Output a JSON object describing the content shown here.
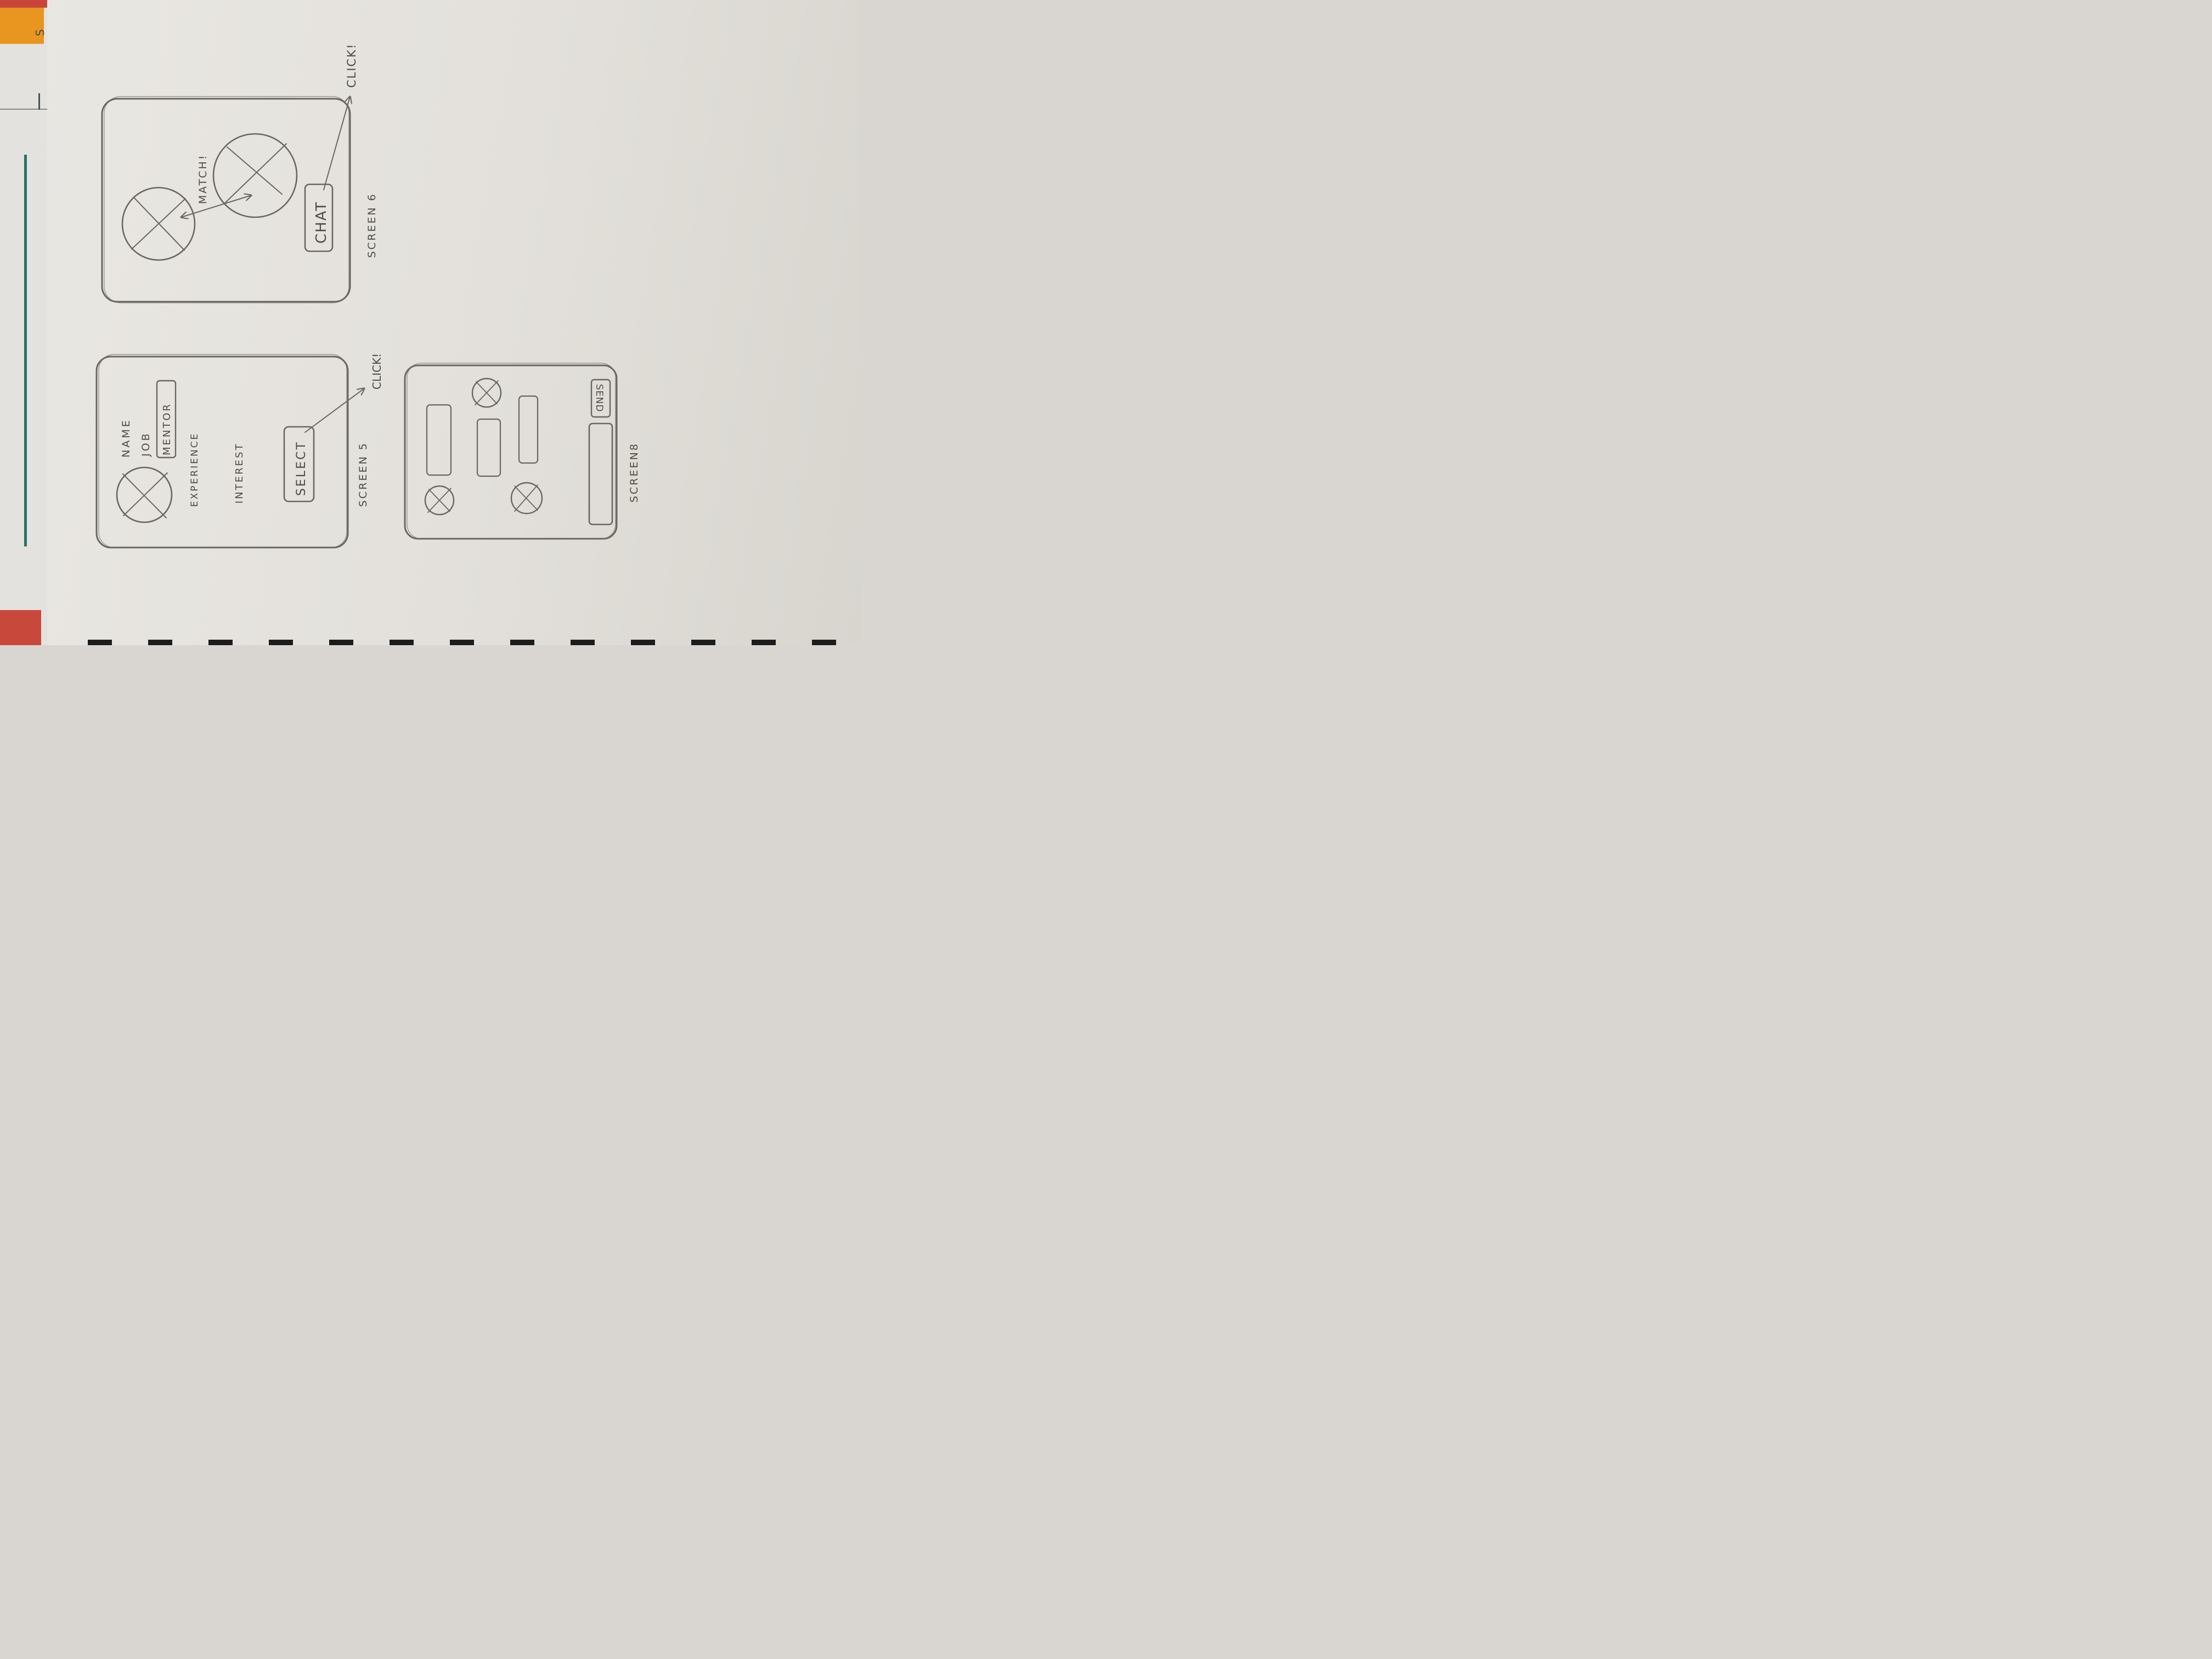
{
  "edge_text": "S",
  "screen5": {
    "caption": "SCREEN 5",
    "name_label": "NAME",
    "job_label": "JOB",
    "mentor_tag": "MENTOR",
    "experience_label": "EXPERIENCE",
    "interest_label": "INTEREST",
    "select_button": "SELECT",
    "click_note": "CLICK!"
  },
  "screen6": {
    "caption": "SCREEN 6",
    "match_label": "MATCH!",
    "chat_button": "CHAT",
    "click_note": "CLICK!"
  },
  "screen8": {
    "caption": "SCREEN8",
    "send_button": "SEND"
  }
}
